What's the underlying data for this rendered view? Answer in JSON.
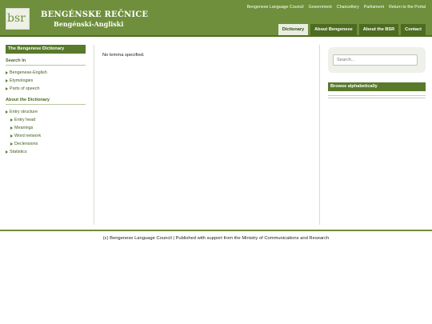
{
  "header": {
    "logo": "bsr",
    "title_line1": "BENGÉNSKE REČNICE",
    "title_line2": "Bengénski-Angliski",
    "topnav": [
      "Bengenese Language Council",
      "Government",
      "Chancellery",
      "Parliament",
      "Return to the Portal"
    ],
    "tabs": [
      {
        "label": "Dictionary",
        "active": true
      },
      {
        "label": "About Bengenese",
        "active": false
      },
      {
        "label": "About the BSR",
        "active": false
      },
      {
        "label": "Contact",
        "active": false
      }
    ]
  },
  "sidebar": {
    "title": "The Bengenese Dictionary",
    "search_heading": "Search In",
    "search_items": [
      "Bengenese-English",
      "Etymologies",
      "Parts of speech"
    ],
    "about_heading": "About the Dictionary",
    "about_items": [
      {
        "label": "Entry structure",
        "sub": false
      },
      {
        "label": "Entry head",
        "sub": true
      },
      {
        "label": "Meanings",
        "sub": true
      },
      {
        "label": "Word network",
        "sub": true
      },
      {
        "label": "Declensions",
        "sub": true
      },
      {
        "label": "Statistics",
        "sub": false
      }
    ]
  },
  "main": {
    "message": "No lemma specified."
  },
  "right": {
    "search_placeholder": "Search...",
    "browse_label": "Browse alphabetically"
  },
  "footer": {
    "text": "(c) Bengenese Language Council | Published with support from the Ministry of Communications and Research"
  },
  "colors": {
    "header_green": "#6f8f3c",
    "tab_dark": "#4d6b21",
    "accent": "#587a2a"
  }
}
